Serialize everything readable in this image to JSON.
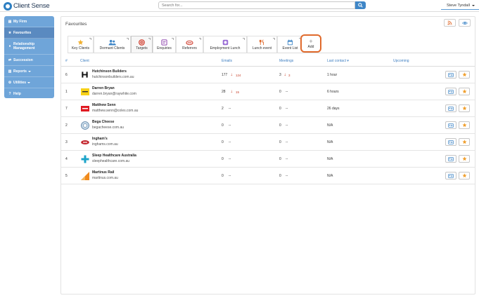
{
  "app": {
    "title": "Client Sense"
  },
  "header": {
    "search_placeholder": "Search for...",
    "user_name": "Steve Tyndall"
  },
  "sidebar": {
    "items": [
      {
        "label": "My Firm",
        "icon": "building-icon"
      },
      {
        "label": "Favourites",
        "icon": "star-icon"
      },
      {
        "label": "Relationship Management",
        "icon": "people-icon"
      },
      {
        "label": "Succession",
        "icon": "shuffle-icon"
      },
      {
        "label": "Reports",
        "icon": "report-icon"
      },
      {
        "label": "Utilities",
        "icon": "utilities-icon"
      },
      {
        "label": "Help",
        "icon": "help-icon"
      }
    ]
  },
  "panel": {
    "title": "Favourites"
  },
  "tabs": [
    {
      "label": "Key Clients",
      "icon": "star-icon"
    },
    {
      "label": "Dormant Clients",
      "icon": "people-icon"
    },
    {
      "label": "Targets",
      "icon": "target-icon"
    },
    {
      "label": "Enquiries",
      "icon": "enquiry-icon"
    },
    {
      "label": "Referrers",
      "icon": "handshake-icon"
    },
    {
      "label": "Employment Lunch",
      "icon": "lunch-icon"
    },
    {
      "label": "Lunch event",
      "icon": "cutlery-icon"
    },
    {
      "label": "Event List",
      "icon": "calendar-icon"
    }
  ],
  "add_tab": {
    "label": "Add"
  },
  "table": {
    "columns": {
      "num": "#",
      "client": "Client",
      "emails": "Emails",
      "meetings": "Meetings",
      "last_contact": "Last contact ▾",
      "upcoming": "Upcoming"
    },
    "rows": [
      {
        "num": "6",
        "name": "Hutchinson Builders",
        "domain": "hutchinsonbuilders.com.au",
        "emails": "177",
        "emails_delta": "124",
        "meetings": "3",
        "meetings_delta": "3",
        "last_contact": "1 hour"
      },
      {
        "num": "1",
        "name": "Darren Bryan",
        "domain": "darren.bryan@raywhite.com",
        "emails": "28",
        "emails_delta": "15",
        "meetings": "0",
        "meetings_delta": "--",
        "last_contact": "6 hours"
      },
      {
        "num": "7",
        "name": "Matthew Senn",
        "domain": "matthew.senn@coles.com.au",
        "emails": "2",
        "emails_delta": "--",
        "meetings": "0",
        "meetings_delta": "--",
        "last_contact": "26 days"
      },
      {
        "num": "2",
        "name": "Bega Cheese",
        "domain": "begacheese.com.au",
        "emails": "0",
        "emails_delta": "--",
        "meetings": "0",
        "meetings_delta": "--",
        "last_contact": "N/A"
      },
      {
        "num": "3",
        "name": "Ingham's",
        "domain": "inghams.com.au",
        "emails": "0",
        "emails_delta": "--",
        "meetings": "0",
        "meetings_delta": "--",
        "last_contact": "N/A"
      },
      {
        "num": "4",
        "name": "Sleep Healthcare Australia",
        "domain": "sleephealthcare.com.au",
        "emails": "0",
        "emails_delta": "--",
        "meetings": "0",
        "meetings_delta": "--",
        "last_contact": "N/A"
      },
      {
        "num": "5",
        "name": "Martinus Rail",
        "domain": "martinus.com.au",
        "emails": "0",
        "emails_delta": "--",
        "meetings": "0",
        "meetings_delta": "--",
        "last_contact": "N/A"
      }
    ]
  },
  "colors": {
    "sidebar": "#6fa5d9",
    "accent": "#3f86c7",
    "highlight": "#e06a2c",
    "star": "#f0a030"
  }
}
